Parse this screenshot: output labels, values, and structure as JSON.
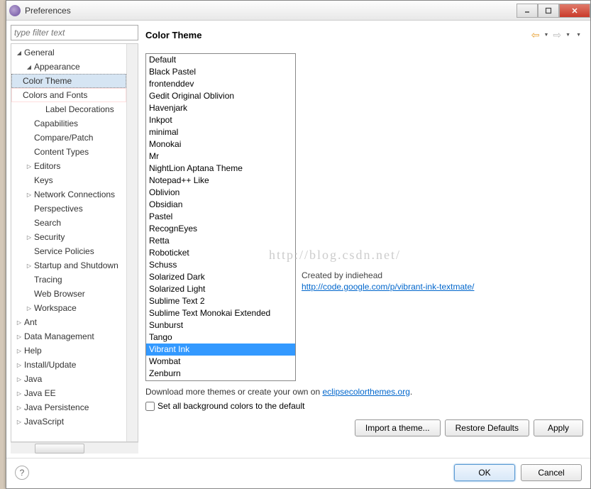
{
  "window": {
    "title": "Preferences"
  },
  "filter": {
    "placeholder": "type filter text"
  },
  "tree": [
    {
      "label": "General",
      "indent": 0,
      "expand": "open"
    },
    {
      "label": "Appearance",
      "indent": 1,
      "expand": "open"
    },
    {
      "label": "Color Theme",
      "indent": 2,
      "selected": true,
      "boxed": true
    },
    {
      "label": "Colors and Fonts",
      "indent": 2,
      "boxed": true
    },
    {
      "label": "Label Decorations",
      "indent": 2
    },
    {
      "label": "Capabilities",
      "indent": 1
    },
    {
      "label": "Compare/Patch",
      "indent": 1
    },
    {
      "label": "Content Types",
      "indent": 1
    },
    {
      "label": "Editors",
      "indent": 1,
      "expand": "closed"
    },
    {
      "label": "Keys",
      "indent": 1
    },
    {
      "label": "Network Connections",
      "indent": 1,
      "expand": "closed"
    },
    {
      "label": "Perspectives",
      "indent": 1
    },
    {
      "label": "Search",
      "indent": 1
    },
    {
      "label": "Security",
      "indent": 1,
      "expand": "closed"
    },
    {
      "label": "Service Policies",
      "indent": 1
    },
    {
      "label": "Startup and Shutdown",
      "indent": 1,
      "expand": "closed"
    },
    {
      "label": "Tracing",
      "indent": 1
    },
    {
      "label": "Web Browser",
      "indent": 1
    },
    {
      "label": "Workspace",
      "indent": 1,
      "expand": "closed"
    },
    {
      "label": "Ant",
      "indent": 0,
      "expand": "closed"
    },
    {
      "label": "Data Management",
      "indent": 0,
      "expand": "closed"
    },
    {
      "label": "Help",
      "indent": 0,
      "expand": "closed"
    },
    {
      "label": "Install/Update",
      "indent": 0,
      "expand": "closed"
    },
    {
      "label": "Java",
      "indent": 0,
      "expand": "closed"
    },
    {
      "label": "Java EE",
      "indent": 0,
      "expand": "closed"
    },
    {
      "label": "Java Persistence",
      "indent": 0,
      "expand": "closed"
    },
    {
      "label": "JavaScript",
      "indent": 0,
      "expand": "closed"
    }
  ],
  "panel": {
    "title": "Color Theme",
    "download_text": "Download more themes or create your own on ",
    "download_link": "eclipsecolorthemes.org",
    "dot": ".",
    "checkbox_label": "Set all background colors to the default",
    "created_by": "Created by indiehead",
    "theme_url": "http://code.google.com/p/vibrant-ink-textmate/"
  },
  "themes": [
    "Default",
    "Black Pastel",
    "frontenddev",
    "Gedit Original Oblivion",
    "Havenjark",
    "Inkpot",
    "minimal",
    "Monokai",
    "Mr",
    "NightLion Aptana Theme",
    "Notepad++ Like",
    "Oblivion",
    "Obsidian",
    "Pastel",
    "RecognEyes",
    "Retta",
    "Roboticket",
    "Schuss",
    "Solarized Dark",
    "Solarized Light",
    "Sublime Text 2",
    "Sublime Text Monokai Extended",
    "Sunburst",
    "Tango",
    "Vibrant Ink",
    "Wombat",
    "Zenburn"
  ],
  "selected_theme": "Vibrant Ink",
  "buttons": {
    "import": "Import a theme...",
    "restore": "Restore Defaults",
    "apply": "Apply",
    "ok": "OK",
    "cancel": "Cancel"
  },
  "watermark": "http://blog.csdn.net/"
}
